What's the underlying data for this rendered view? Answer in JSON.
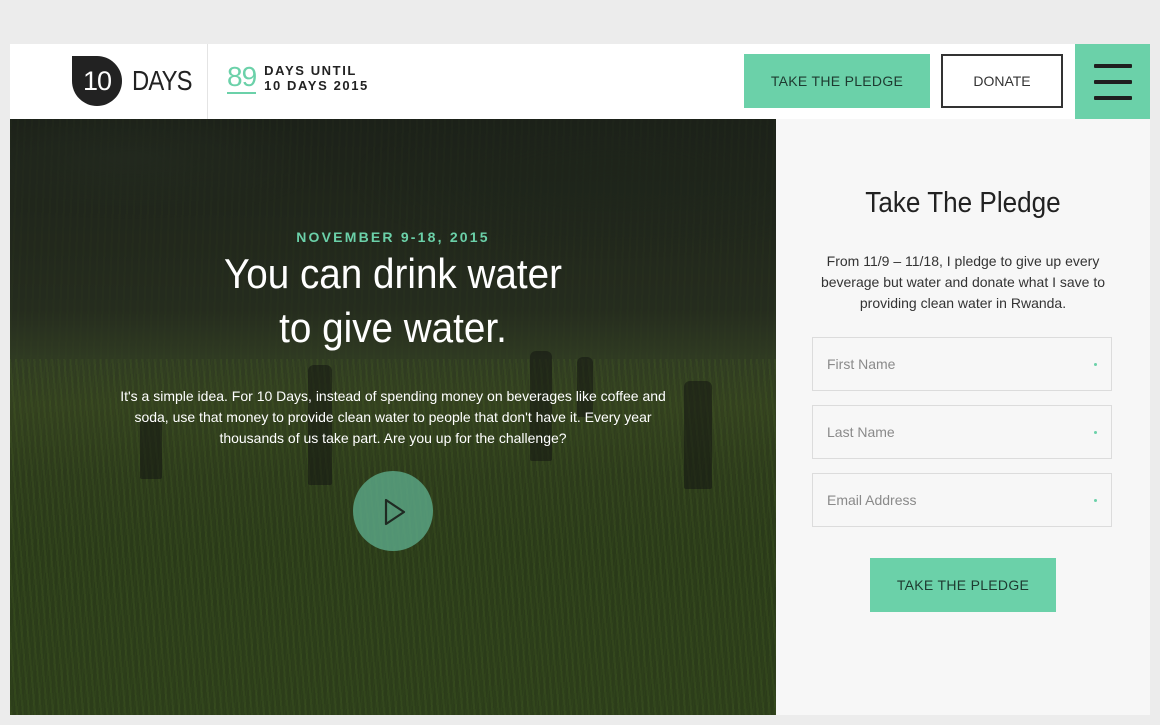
{
  "colors": {
    "accent": "#6bd1a9",
    "dark": "#222222"
  },
  "header": {
    "logo_number": "10",
    "logo_word": "DAYS",
    "countdown_number": "89",
    "countdown_line1": "DAYS UNTIL",
    "countdown_line2": "10 DAYS 2015",
    "pledge_button": "TAKE THE PLEDGE",
    "donate_button": "DONATE",
    "menu_icon": "hamburger-menu-icon"
  },
  "hero": {
    "date": "NOVEMBER 9-18, 2015",
    "title_line1": "You can drink water",
    "title_line2": "to give water.",
    "body": "It's a simple idea. For 10 Days, instead of spending money on beverages like coffee and soda, use that money to provide clean water to people that don't have it. Every year thousands of us take part. Are you up for the challenge?",
    "play_icon": "play-icon"
  },
  "pledge": {
    "title": "Take The Pledge",
    "description": "From 11/9 – 11/18, I pledge to give up every beverage but water and donate what I save to providing clean water in Rwanda.",
    "fields": [
      {
        "placeholder": "First Name",
        "value": ""
      },
      {
        "placeholder": "Last Name",
        "value": ""
      },
      {
        "placeholder": "Email Address",
        "value": ""
      }
    ],
    "submit_button": "TAKE THE PLEDGE"
  }
}
